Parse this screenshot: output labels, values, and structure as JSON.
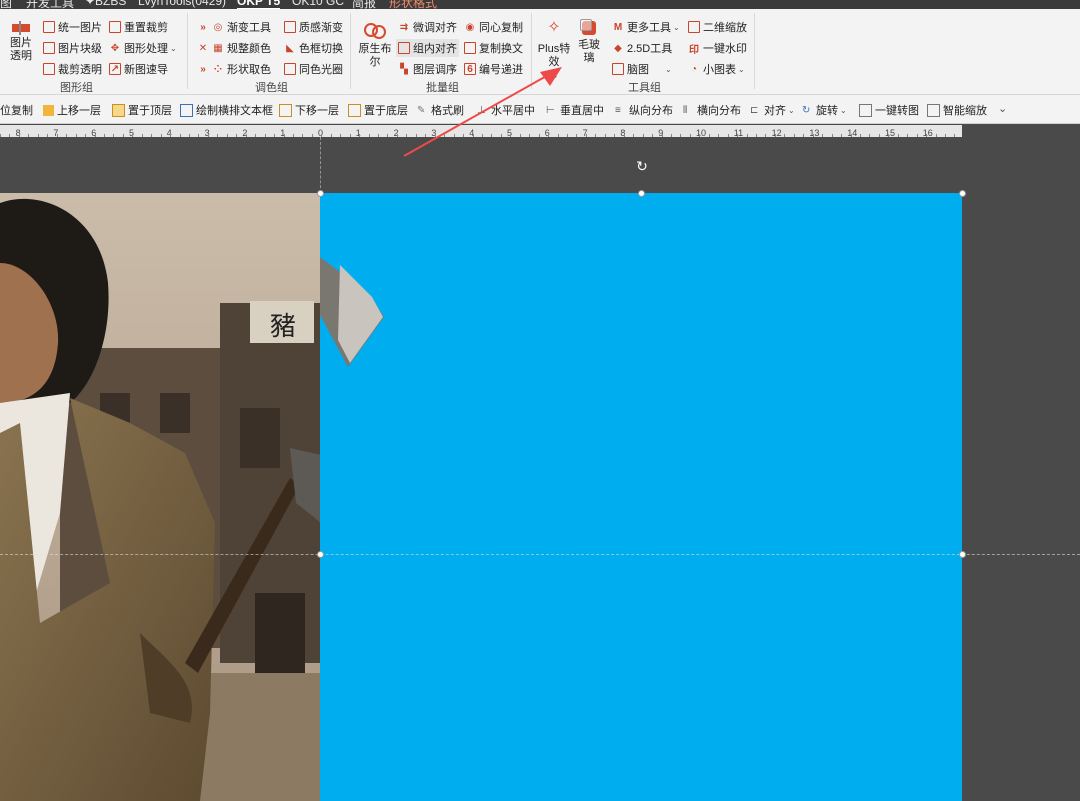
{
  "tabs": [
    "图",
    "开发工具",
    "✦BZBS",
    "LvynTools(0429)",
    "OKP T5",
    "OK10 GC",
    "简报",
    "形状格式"
  ],
  "ribbon": {
    "big_buttons": {
      "picture_transparent": "图片\n透明",
      "original_layout": "原生布\n尔",
      "plus_effect": "Plus特\n效",
      "frosted_glass": "毛玻\n璃"
    },
    "col1": [
      "统一图片",
      "图片块级",
      "裁剪透明"
    ],
    "col2": [
      "重置裁剪",
      "图形处理",
      "新图速导"
    ],
    "col3": [
      "渐变工具",
      "规整颜色",
      "形状取色"
    ],
    "col4": [
      "质感渐变",
      "色框切换",
      "同色光圈"
    ],
    "col5": [
      "微调对齐",
      "组内对齐",
      "图层调序"
    ],
    "col6": [
      "同心复制",
      "复制换文",
      "编号递进"
    ],
    "col7": [
      "更多工具",
      "2.5D工具",
      "脑图"
    ],
    "col8": [
      "二维缩放",
      "一键水印",
      "小图表"
    ],
    "groups": [
      "图形组",
      "调色组",
      "批量组",
      "工具组"
    ]
  },
  "quickbar": [
    "位复制",
    "上移一层",
    "置于顶层",
    "绘制横排文本框",
    "下移一层",
    "置于底层",
    "格式刷",
    "水平居中",
    "垂直居中",
    "纵向分布",
    "横向分布",
    "对齐",
    "旋转",
    "一键转图",
    "智能缩放"
  ],
  "ruler_labels": [
    "8",
    "7",
    "6",
    "5",
    "4",
    "3",
    "2",
    "1",
    "0",
    "1",
    "2",
    "3",
    "4",
    "5",
    "6",
    "7",
    "8",
    "9",
    "10",
    "11",
    "12",
    "13",
    "14",
    "15",
    "16"
  ],
  "canvas": {
    "rect_color": "#00aeef",
    "photo_sign": "豬",
    "annotation_arrow_color": "#ef4a4a"
  }
}
